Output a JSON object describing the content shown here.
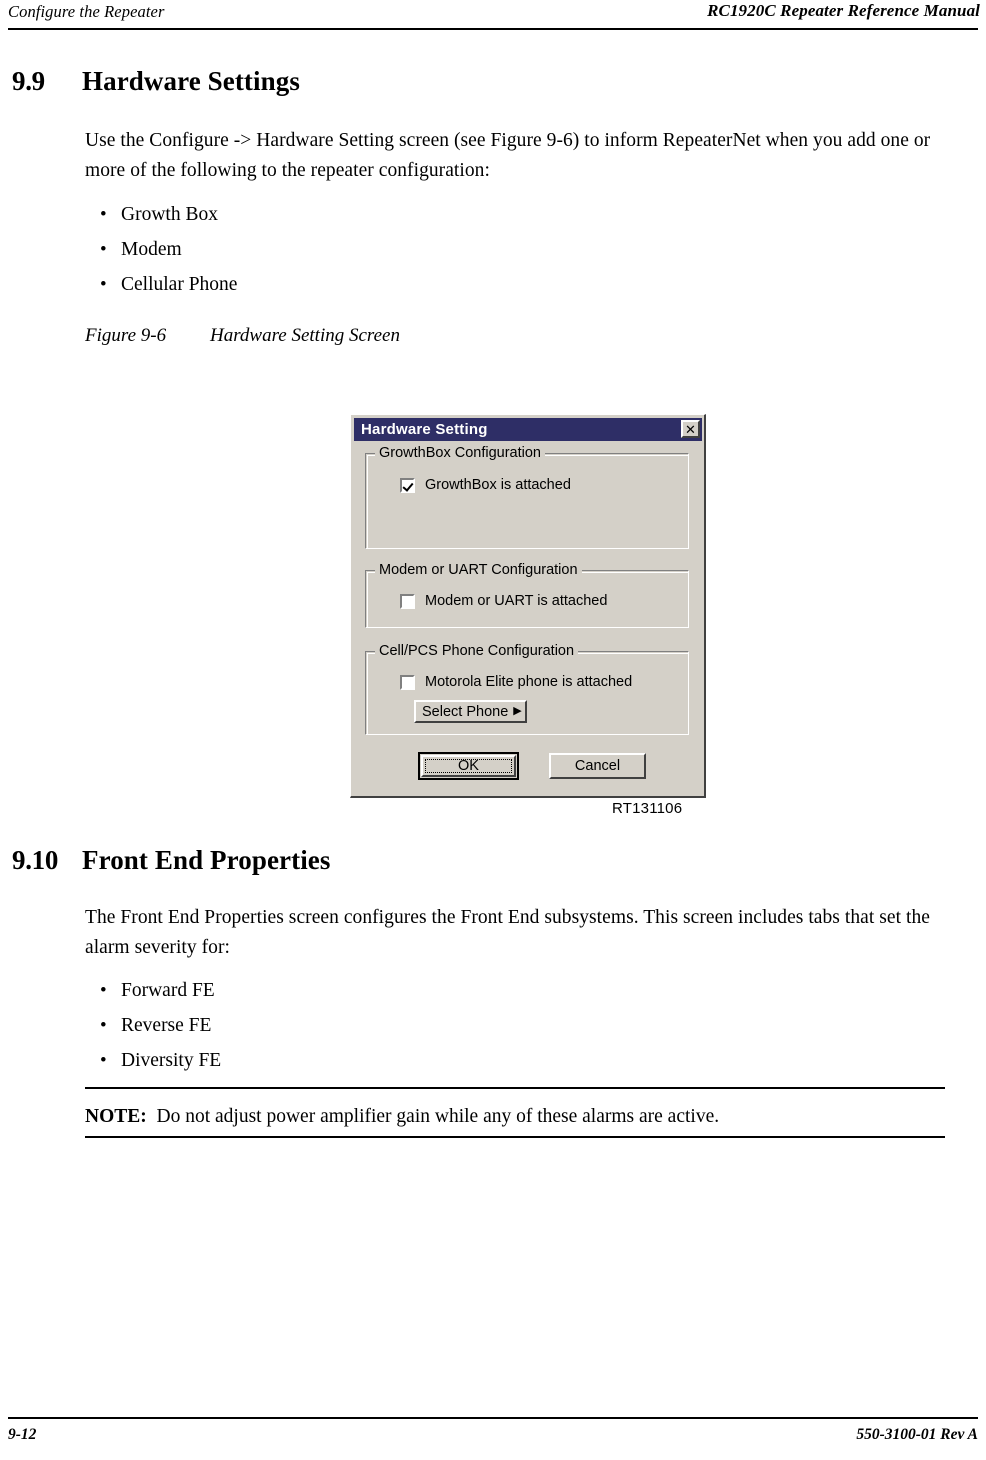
{
  "header": {
    "left": "Configure the Repeater",
    "right": "RC1920C Repeater Reference Manual"
  },
  "footer": {
    "page_number": "9-12",
    "document_number": "550-3100-01 Rev A"
  },
  "sections": [
    {
      "number": "9.9",
      "title": "Hardware Settings",
      "paragraph": "Use the Configure -> Hardware Setting screen (see Figure 9-6) to inform RepeaterNet when you add one or more of the following to the repeater configuration:",
      "bullets": [
        "Growth Box",
        "Modem",
        "Cellular Phone"
      ]
    },
    {
      "number": "9.10",
      "title": "Front End Properties",
      "paragraph": "The Front End Properties screen configures the Front End subsystems. This screen includes tabs that set the alarm severity for:",
      "bullets": [
        "Forward FE",
        "Reverse FE",
        "Diversity FE"
      ]
    }
  ],
  "figure": {
    "caption_number": "Figure 9-6",
    "caption_title": "Hardware Setting Screen",
    "figure_id": "RT131106",
    "dialog": {
      "title": "Hardware Setting",
      "close_icon": "close-icon",
      "groups": [
        {
          "legend": "GrowthBox Configuration",
          "checkbox_label": "GrowthBox is attached",
          "checked": true
        },
        {
          "legend": "Modem or UART Configuration",
          "checkbox_label": "Modem or UART is attached",
          "checked": false
        },
        {
          "legend": "Cell/PCS Phone Configuration",
          "checkbox_label": "Motorola Elite phone is attached",
          "checked": false,
          "button_label": "Select Phone",
          "button_arrow": "▶"
        }
      ],
      "buttons": {
        "ok": "OK",
        "cancel": "Cancel"
      },
      "colors": {
        "titlebar": "#2e2e66",
        "face": "#d4d0c8",
        "shadow": "#404040",
        "highlight": "#ffffff"
      }
    }
  },
  "note": {
    "label": "NOTE:",
    "text": "Do not adjust power amplifier gain while any of these alarms are active."
  }
}
